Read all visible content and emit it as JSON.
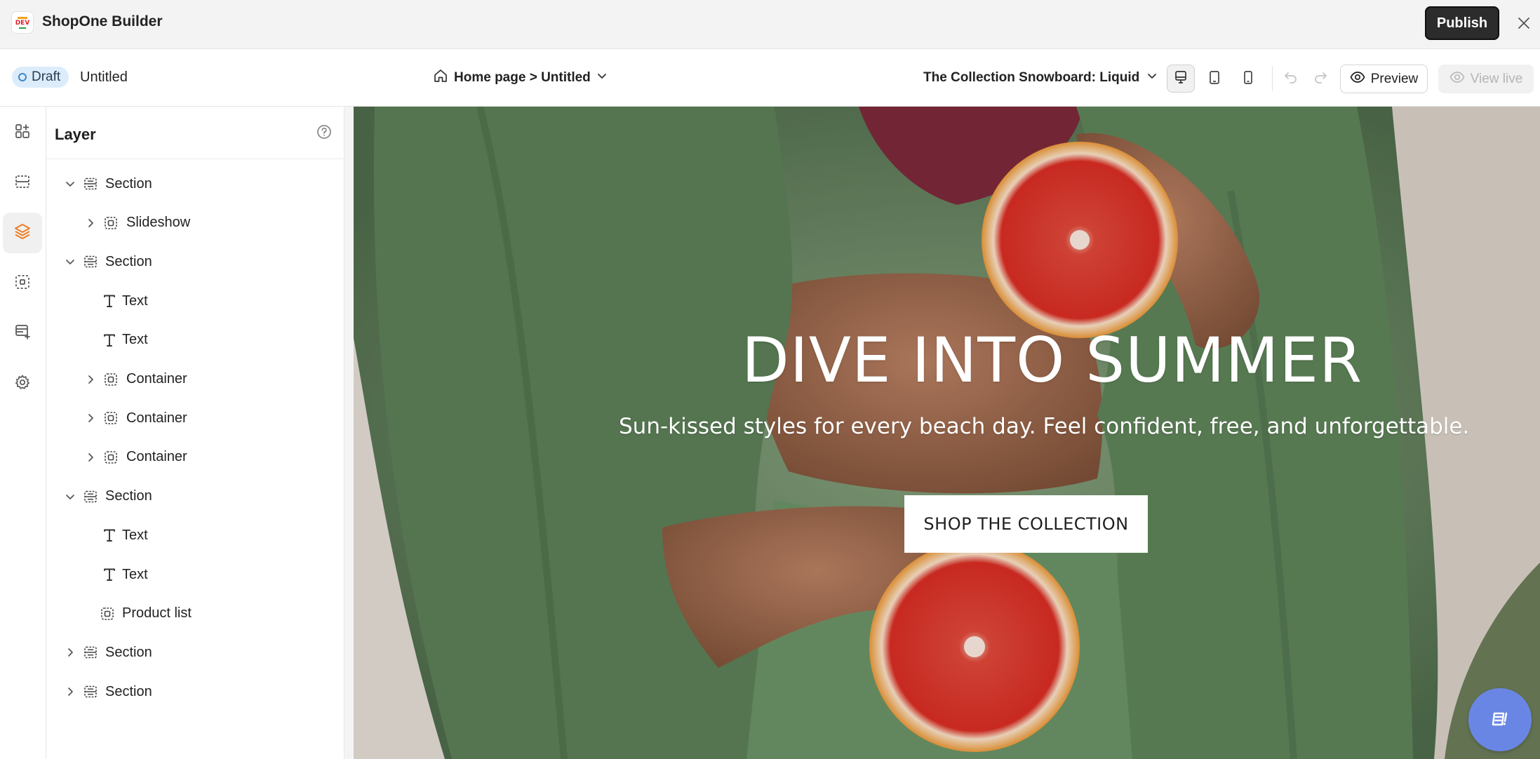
{
  "app": {
    "title": "ShopOne Builder",
    "logo_text": "DEV",
    "publish_label": "Publish"
  },
  "toolbar": {
    "status_badge": "Draft",
    "page_name": "Untitled",
    "breadcrumb": "Home page > Untitled",
    "template": "The Collection Snowboard: Liquid",
    "preview_label": "Preview",
    "view_live_label": "View live"
  },
  "layer_panel": {
    "title": "Layer",
    "items": [
      {
        "label": "Section",
        "icon": "section-icon",
        "level": 0,
        "expanded": true
      },
      {
        "label": "Slideshow",
        "icon": "component-icon",
        "level": 1,
        "expanded": false
      },
      {
        "label": "Section",
        "icon": "section-icon",
        "level": 0,
        "expanded": true
      },
      {
        "label": "Text",
        "icon": "text-icon",
        "level": 1
      },
      {
        "label": "Text",
        "icon": "text-icon",
        "level": 1
      },
      {
        "label": "Container",
        "icon": "component-icon",
        "level": 1,
        "expanded": false
      },
      {
        "label": "Container",
        "icon": "component-icon",
        "level": 1,
        "expanded": false
      },
      {
        "label": "Container",
        "icon": "component-icon",
        "level": 1,
        "expanded": false
      },
      {
        "label": "Section",
        "icon": "section-icon",
        "level": 0,
        "expanded": true
      },
      {
        "label": "Text",
        "icon": "text-icon",
        "level": 1
      },
      {
        "label": "Text",
        "icon": "text-icon",
        "level": 1
      },
      {
        "label": "Product list",
        "icon": "component-icon",
        "level": 1
      },
      {
        "label": "Section",
        "icon": "section-icon",
        "level": 0,
        "expanded": false
      },
      {
        "label": "Section",
        "icon": "section-icon",
        "level": 0,
        "expanded": false
      }
    ]
  },
  "canvas": {
    "hero_title": "DIVE INTO SUMMER",
    "hero_subtitle": "Sun-kissed styles for every beach day. Feel confident, free, and unforgettable.",
    "cta_label": "SHOP THE COLLECTION"
  },
  "colors": {
    "accent": "#f07b22",
    "publish_bg": "#2c2c2c",
    "draft_badge_bg": "#dcecfa",
    "chat_bubble": "#6a86e4"
  }
}
